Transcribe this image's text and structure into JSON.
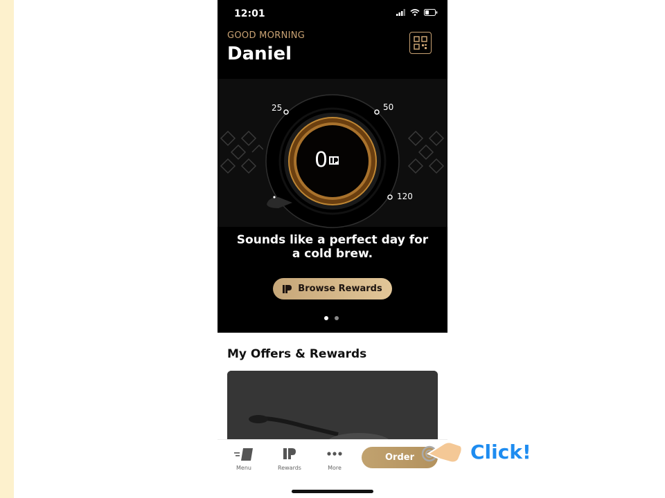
{
  "status_bar": {
    "time": "12:01"
  },
  "header": {
    "greeting": "GOOD MORNING",
    "username": "Daniel"
  },
  "dial": {
    "tick_labels": [
      "25",
      "50",
      "120"
    ],
    "points": "0"
  },
  "promo": {
    "message": "Sounds like a perfect day for a cold brew."
  },
  "browse_button": {
    "label": "Browse Rewards"
  },
  "carousel": {
    "pages": 2,
    "active_page": 1
  },
  "offers": {
    "title": "My Offers & Rewards"
  },
  "tabbar": {
    "items": [
      {
        "label": "Menu",
        "icon": "menu-cup-icon"
      },
      {
        "label": "Rewards",
        "icon": "rewards-p-icon"
      },
      {
        "label": "More",
        "icon": "more-dots-icon"
      }
    ],
    "order_label": "Order"
  },
  "tutorial": {
    "hint_text": "Click!"
  },
  "colors": {
    "gold": "#c9a273",
    "hint_blue": "#1e8cf0",
    "hero_bg": "#000000"
  }
}
